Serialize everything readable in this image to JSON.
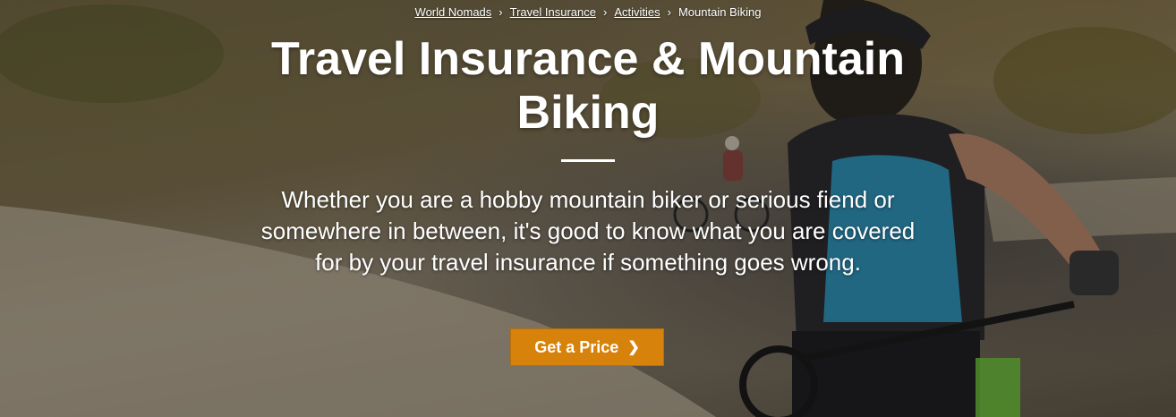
{
  "breadcrumb": {
    "items": [
      "World Nomads",
      "Travel Insurance",
      "Activities"
    ],
    "current": "Mountain Biking",
    "separator": "›"
  },
  "hero": {
    "title": "Travel Insurance & Mountain Biking",
    "description": "Whether you are a hobby mountain biker or serious fiend or somewhere in between, it's good to know what you are covered for by your travel insurance if something goes wrong.",
    "cta_label": "Get a Price",
    "cta_icon": "chevron-right-icon"
  },
  "colors": {
    "accent": "#d7820a",
    "text": "#ffffff"
  }
}
